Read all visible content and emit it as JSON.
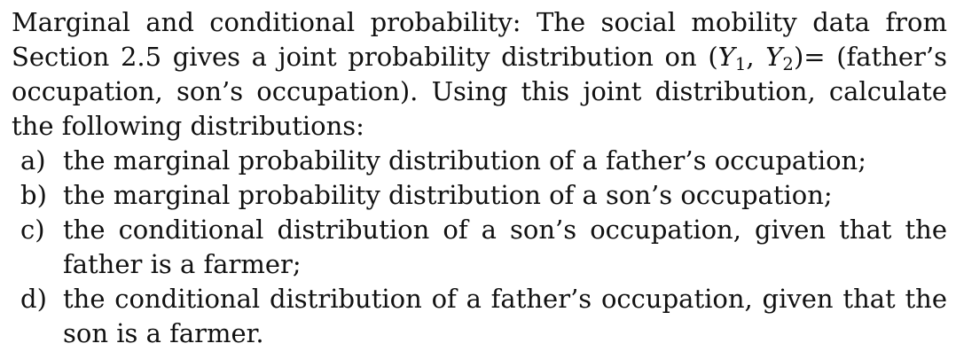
{
  "problem": {
    "intro_before_math": "Marginal and conditional probability: The social mobility data from Section 2.5 gives a joint probability distribution on ",
    "math": {
      "open": "(",
      "y1": "Y",
      "sub1": "1",
      "comma": ", ",
      "y2": "Y",
      "sub2": "2",
      "close": ")"
    },
    "intro_after_math": "= (father’s occupation, son’s occupation). Using this joint distribution, calculate the following distributions:",
    "items": [
      {
        "marker": "a)",
        "text": "the marginal probability distribution of a father’s occupation;"
      },
      {
        "marker": "b)",
        "text": "the marginal probability distribution of a son’s occupation;"
      },
      {
        "marker": "c)",
        "text": "the conditional distribution of a son’s occupation, given that the father is a farmer;"
      },
      {
        "marker": "d)",
        "text": "the conditional distribution of a father’s occupation, given that the son is a farmer."
      }
    ]
  }
}
